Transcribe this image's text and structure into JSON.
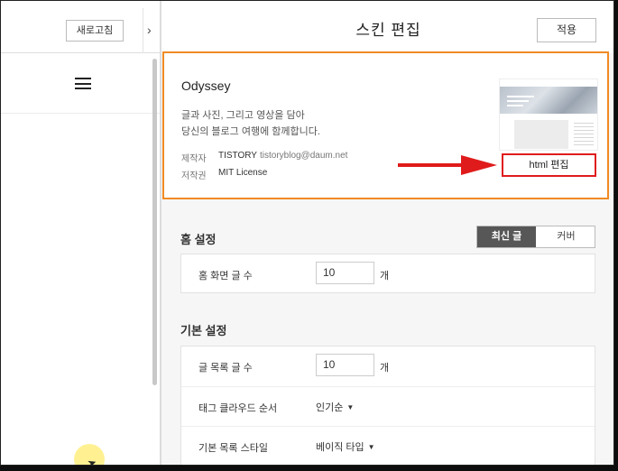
{
  "left_panel": {
    "refresh_label": "새로고침",
    "collapse_icon": "›"
  },
  "header": {
    "title": "스킨 편집",
    "apply_label": "적용"
  },
  "skin": {
    "name": "Odyssey",
    "description_line1": "글과 사진, 그리고 영상을 담아",
    "description_line2": "당신의 블로그 여행에 함께합니다.",
    "author_label": "제작자",
    "author_name": "TISTORY",
    "author_email": "tistoryblog@daum.net",
    "license_label": "저작권",
    "license_value": "MIT License",
    "html_edit_label": "html 편집",
    "highlight_color": "#e01b1b",
    "card_border_color": "#f08a24"
  },
  "home_settings": {
    "title": "홈 설정",
    "tabs": [
      {
        "label": "최신 글",
        "active": true
      },
      {
        "label": "커버",
        "active": false
      }
    ],
    "post_count_label": "홈 화면 글 수",
    "post_count_value": "10",
    "post_count_unit": "개"
  },
  "basic_settings": {
    "title": "기본 설정",
    "list_count_label": "글 목록 글 수",
    "list_count_value": "10",
    "list_count_unit": "개",
    "tag_cloud_label": "태그 클라우드 순서",
    "tag_cloud_value": "인기순",
    "list_style_label": "기본 목록 스타일",
    "list_style_value": "베이직 타입"
  }
}
